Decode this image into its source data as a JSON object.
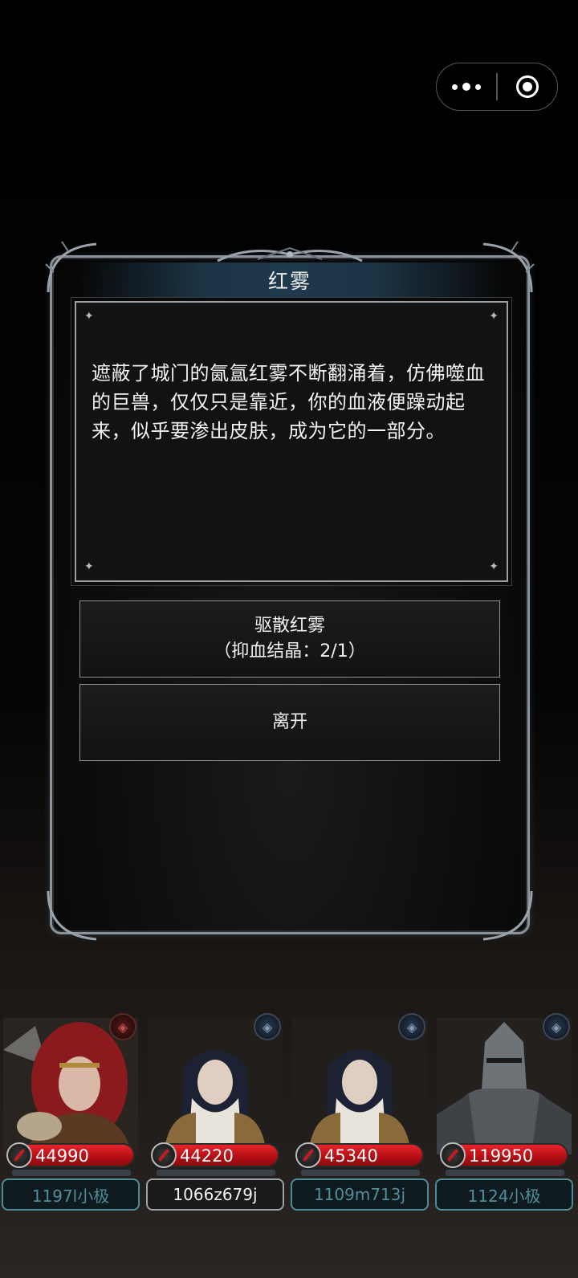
{
  "capsule": {
    "more_icon": "more-dots-icon",
    "close_icon": "target-close-icon"
  },
  "event": {
    "title": "红雾",
    "story": "遮蔽了城门的氤氲红雾不断翻涌着，仿佛噬血的巨兽，仅仅只是靠近，你的血液便躁动起来，似乎要渗出皮肤，成为它的一部分。",
    "options": [
      {
        "label": "驱散红雾",
        "cost": "（抑血结晶：2/1）"
      },
      {
        "label": "离开"
      }
    ]
  },
  "party": [
    {
      "hp": "44990",
      "name": "1197l小极",
      "portrait": "red-haired-warrior",
      "emblem": "red"
    },
    {
      "hp": "44220",
      "name": "1066z679j",
      "portrait": "nun",
      "emblem": "blue"
    },
    {
      "hp": "45340",
      "name": "1109m713j",
      "portrait": "nun",
      "emblem": "blue"
    },
    {
      "hp": "119950",
      "name": "1124小极",
      "portrait": "armored-knight",
      "emblem": "blue"
    }
  ],
  "colors": {
    "hp_red": "#d0161c",
    "name_teal": "#4f8e9a",
    "frame_silver": "#8b9299",
    "title_bar": "#1f3a4c"
  }
}
